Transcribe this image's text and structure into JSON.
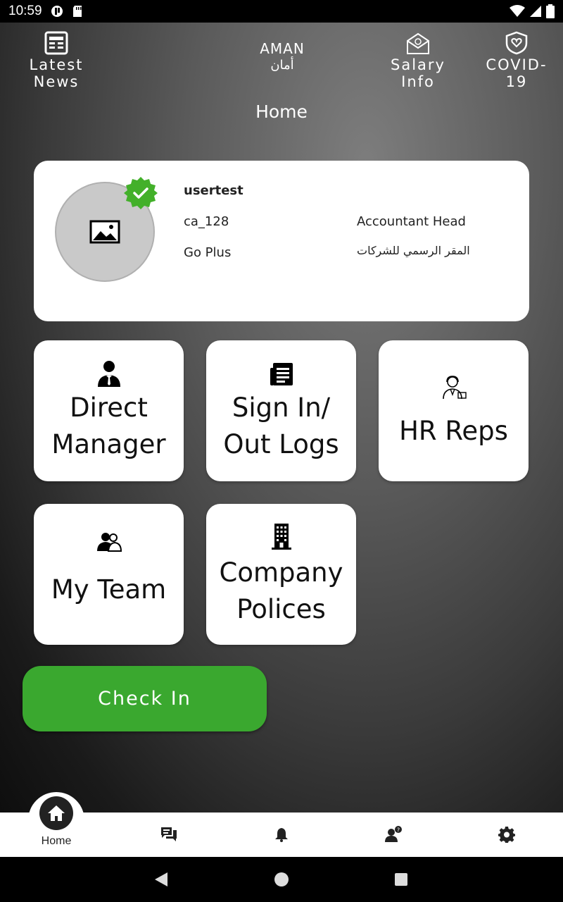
{
  "status_bar": {
    "time": "10:59"
  },
  "top_nav": {
    "latest_news": "Latest News",
    "salary_info": "Salary Info",
    "covid": "COVID-19"
  },
  "logo": {
    "text_en": "AMAN",
    "text_ar": "أمان"
  },
  "page_title": "Home",
  "profile": {
    "name": "usertest",
    "code": "ca_128",
    "job_title": "Accountant Head",
    "company": "Go Plus",
    "location": "المقر الرسمي للشركات"
  },
  "tiles": {
    "direct_manager_l1": "Direct",
    "direct_manager_l2": "Manager",
    "logs_l1": "Sign In/",
    "logs_l2": "Out Logs",
    "hr_reps": "HR Reps",
    "my_team": "My Team",
    "policies_l1": "Company",
    "policies_l2": "Polices"
  },
  "check_in_label": "Check In",
  "bottom_nav": {
    "home_label": "Home"
  },
  "colors": {
    "accent_green": "#3aa82f",
    "verified_green": "#43b02a"
  },
  "icons": [
    "news-icon",
    "salary-icon",
    "covid-shield-icon",
    "verified-badge-icon",
    "image-placeholder-icon",
    "manager-icon",
    "logs-icon",
    "hr-rep-icon",
    "team-icon",
    "building-icon",
    "home-icon",
    "chat-icon",
    "bell-icon",
    "user-question-icon",
    "gear-icon"
  ]
}
